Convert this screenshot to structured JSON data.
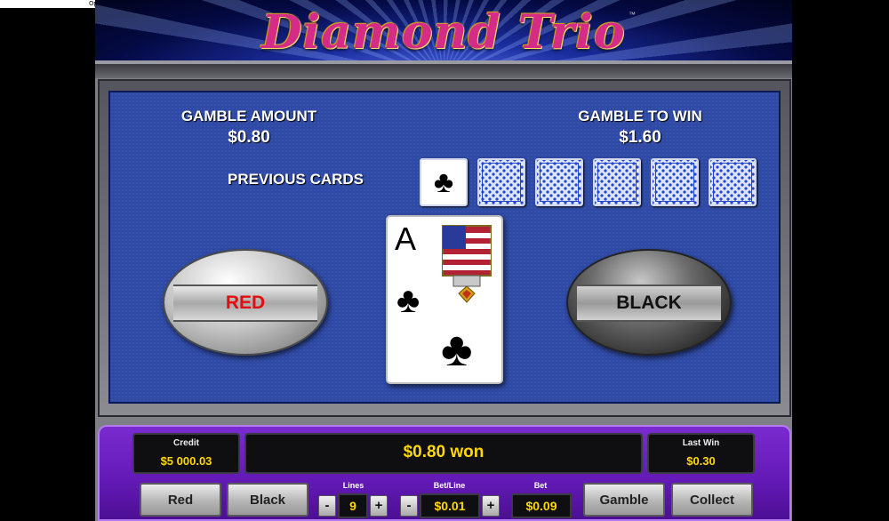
{
  "topbar": {
    "open_controls": "Open Controls"
  },
  "game": {
    "title": "Diamond Trio",
    "trademark": "™"
  },
  "gamble": {
    "amount_label": "GAMBLE AMOUNT",
    "amount_value": "$0.80",
    "to_win_label": "GAMBLE TO WIN",
    "to_win_value": "$1.60",
    "previous_cards_label": "PREVIOUS CARDS",
    "previous_cards": [
      {
        "type": "face",
        "suit": "♣"
      },
      {
        "type": "back"
      },
      {
        "type": "back"
      },
      {
        "type": "back"
      },
      {
        "type": "back"
      },
      {
        "type": "back"
      }
    ],
    "red_button": "RED",
    "black_button": "BLACK",
    "current_card": {
      "rank": "A",
      "suit": "♣"
    }
  },
  "status": {
    "credit_label": "Credit",
    "credit_value": "$5 000.03",
    "won_text": "$0.80 won",
    "last_win_label": "Last Win",
    "last_win_value": "$0.30"
  },
  "controls": {
    "red": "Red",
    "black": "Black",
    "lines_label": "Lines",
    "lines_value": "9",
    "bet_line_label": "Bet/Line",
    "bet_line_value": "$0.01",
    "bet_label": "Bet",
    "bet_value": "$0.09",
    "minus": "-",
    "plus": "+",
    "gamble": "Gamble",
    "collect": "Collect"
  },
  "colors": {
    "accent_yellow": "#ffd800",
    "panel_blue": "#2f4aa6",
    "purple": "#6219b5",
    "red_text": "#e01010"
  },
  "icons": [
    "sound-icon",
    "fullscreen-icon",
    "clubs-icon",
    "flag-emblem-icon"
  ]
}
